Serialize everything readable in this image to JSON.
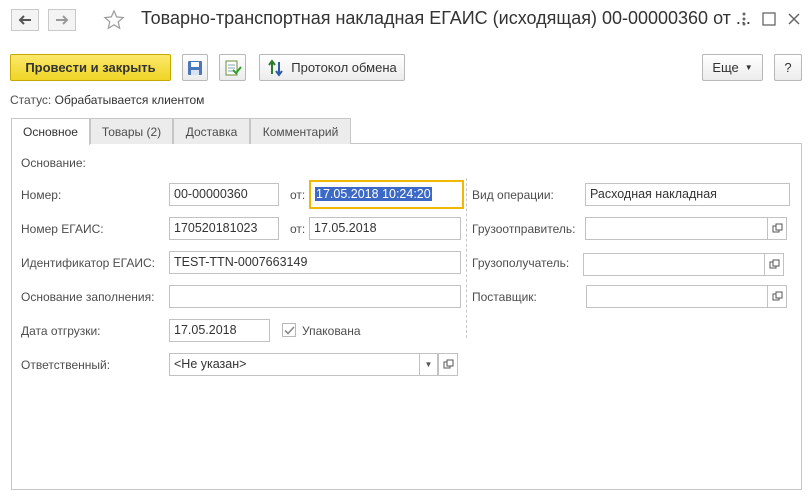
{
  "header": {
    "title": "Товарно-транспортная накладная ЕГАИС (исходящая) 00-00000360 от ...",
    "more_icon": "more-vertical-icon",
    "expand_icon": "expand-icon",
    "close_icon": "close-icon"
  },
  "toolbar": {
    "post_close_label": "Провести и закрыть",
    "protocol_label": "Протокол обмена",
    "more_label": "Еще",
    "help_label": "?"
  },
  "status": {
    "label": "Статус:",
    "value": "Обрабатывается клиентом"
  },
  "tabs": [
    {
      "label": "Основное"
    },
    {
      "label": "Товары (2)"
    },
    {
      "label": "Доставка"
    },
    {
      "label": "Комментарий"
    }
  ],
  "form": {
    "basis_label": "Основание:",
    "number_label": "Номер:",
    "number_value": "00-00000360",
    "from_label": "от:",
    "date_value": "17.05.2018 10:24:20",
    "egais_number_label": "Номер ЕГАИС:",
    "egais_number_value": "170520181023",
    "egais_from_label": "от:",
    "egais_date_value": "17.05.2018",
    "egais_id_label": "Идентификатор ЕГАИС:",
    "egais_id_value": "TEST-TTN-0007663149",
    "fill_basis_label": "Основание заполнения:",
    "fill_basis_value": "",
    "ship_date_label": "Дата отгрузки:",
    "ship_date_value": "17.05.2018",
    "packed_label": "Упакована",
    "responsible_label": "Ответственный:",
    "responsible_value": "<Не указан>",
    "operation_label": "Вид операции:",
    "operation_value": "Расходная накладная",
    "shipper_label": "Грузоотправитель:",
    "shipper_value": "",
    "consignee_label": "Грузополучатель:",
    "consignee_value": "",
    "supplier_label": "Поставщик:",
    "supplier_value": ""
  }
}
